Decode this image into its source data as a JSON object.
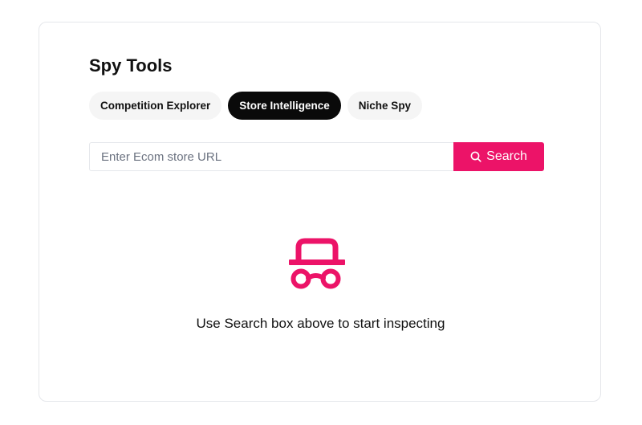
{
  "panel": {
    "title": "Spy Tools"
  },
  "tabs": [
    {
      "label": "Competition Explorer",
      "active": false
    },
    {
      "label": "Store Intelligence",
      "active": true
    },
    {
      "label": "Niche Spy",
      "active": false
    }
  ],
  "search": {
    "placeholder": "Enter Ecom store URL",
    "value": "",
    "button_label": "Search",
    "button_icon": "search-icon"
  },
  "empty_state": {
    "icon": "spy-icon",
    "message": "Use Search box above to start inspecting"
  },
  "colors": {
    "accent": "#ec1368",
    "active_tab_bg": "#0a0a0a",
    "inactive_tab_bg": "#f5f5f5",
    "border": "#e5e7eb"
  }
}
